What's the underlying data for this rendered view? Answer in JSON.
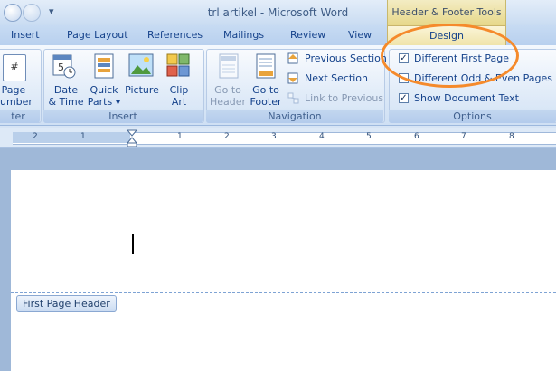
{
  "titlebar": {
    "title": "trl artikel - Microsoft Word",
    "contextual_tab_group": "Header & Footer Tools",
    "qat_dropdown": "▾"
  },
  "tabs": [
    "Insert",
    "Page Layout",
    "References",
    "Mailings",
    "Review",
    "View"
  ],
  "active_tab": "Design",
  "ribbon": {
    "page_number_label": "Page\nNumber",
    "page_number_left": "Page",
    "page_number_right": "umber",
    "header_footer_group_tail": "ter",
    "insert_group": {
      "label": "Insert",
      "date_time_1": "Date",
      "date_time_2": "& Time",
      "quick_parts_1": "Quick",
      "quick_parts_2": "Parts",
      "picture": "Picture",
      "clip_art_1": "Clip",
      "clip_art_2": "Art"
    },
    "navigation_group": {
      "label": "Navigation",
      "goto_header_1": "Go to",
      "goto_header_2": "Header",
      "goto_footer_1": "Go to",
      "goto_footer_2": "Footer",
      "previous_section": "Previous Section",
      "next_section": "Next Section",
      "link_to_previous": "Link to Previous"
    },
    "options_group": {
      "label": "Options",
      "different_first_page": "Different First Page",
      "different_odd_even": "Different Odd & Even Pages",
      "show_document_text": "Show Document Text",
      "different_first_page_checked": true,
      "different_odd_even_checked": false,
      "show_document_text_checked": true
    }
  },
  "ruler": {
    "numbers": [
      "2",
      "1",
      "1",
      "2",
      "3",
      "4",
      "5",
      "6",
      "7",
      "8"
    ]
  },
  "document": {
    "header_tag": "First Page Header"
  },
  "colors": {
    "annotation": "#f58a2b",
    "accent": "#15428b"
  }
}
